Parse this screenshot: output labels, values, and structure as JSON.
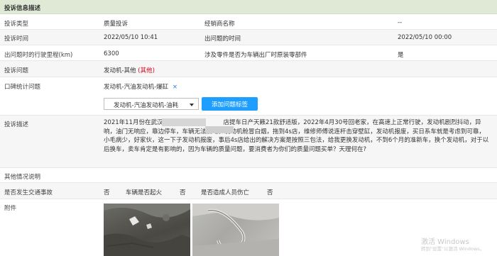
{
  "section_title": "投诉信息描述",
  "rows": {
    "type_label": "投诉类型",
    "type_value": "质量投诉",
    "dealer_label": "经销商名称",
    "dealer_value": "--",
    "time_label": "投诉时间",
    "time_value": "2022/05/10 10:41",
    "issue_time_label": "出问题的时间",
    "issue_time_value": "2022/05/10 00:00",
    "mileage_label": "出问题时的行驶里程(km)",
    "mileage_value": "6300",
    "parts_label": "涉及零件是否为车辆出厂时原装零部件",
    "parts_value": "是",
    "problem_label": "投诉问题",
    "problem_value": "发动机-其他",
    "problem_tag": "(其他)",
    "koubei_label": "口碑统计问题",
    "koubei_tag": "发动机-汽油发动机-爆缸",
    "koubei_tag_close": "×",
    "select_value": "发动机-汽油发动机-油耗",
    "add_tag_button": "添加问题标签",
    "desc_label": "投诉描述",
    "desc_text": "2021年11月份在武汉　　　　　　　　　　店提车日产天籁21款舒适版，2022年4月30号回老家，在高速上正常行驶，发动机剧烈抖动，异响，油门无响应，靠边停车，车辆无法启动，发动机舱冒白烟，拖到4s店，维修师傅说连杆击穿壁缸，发动机报废，买日系车就是考虑到可靠，小毛病少，好家伙，这一下子发动机报废，事后4s店给出的解决方案是按照三包法，给我更换发动机，不到6个月的准新车，换个发动机，对于以后换车，卖车肯定是有影响的，因为车辆的质量问题，要消费者为你们的质量问题买单？天理何在?",
    "other_label": "其他情况说明",
    "accident_label": "是否发生交通事故",
    "accident_value": "否",
    "fire_label": "车辆是否起火",
    "fire_value": "否",
    "injury_label": "是否造成人员伤亡",
    "injury_value": "否",
    "attach_label": "附件"
  },
  "watermark": {
    "line1": "激活 Windows",
    "line2": "转到\"设置\"以激活 Windows。"
  },
  "colors": {
    "header_bg": "#dfe9d5",
    "button_blue": "#1e9fff",
    "tag_red": "#d9001b",
    "close_blue": "#2b7bd6"
  }
}
